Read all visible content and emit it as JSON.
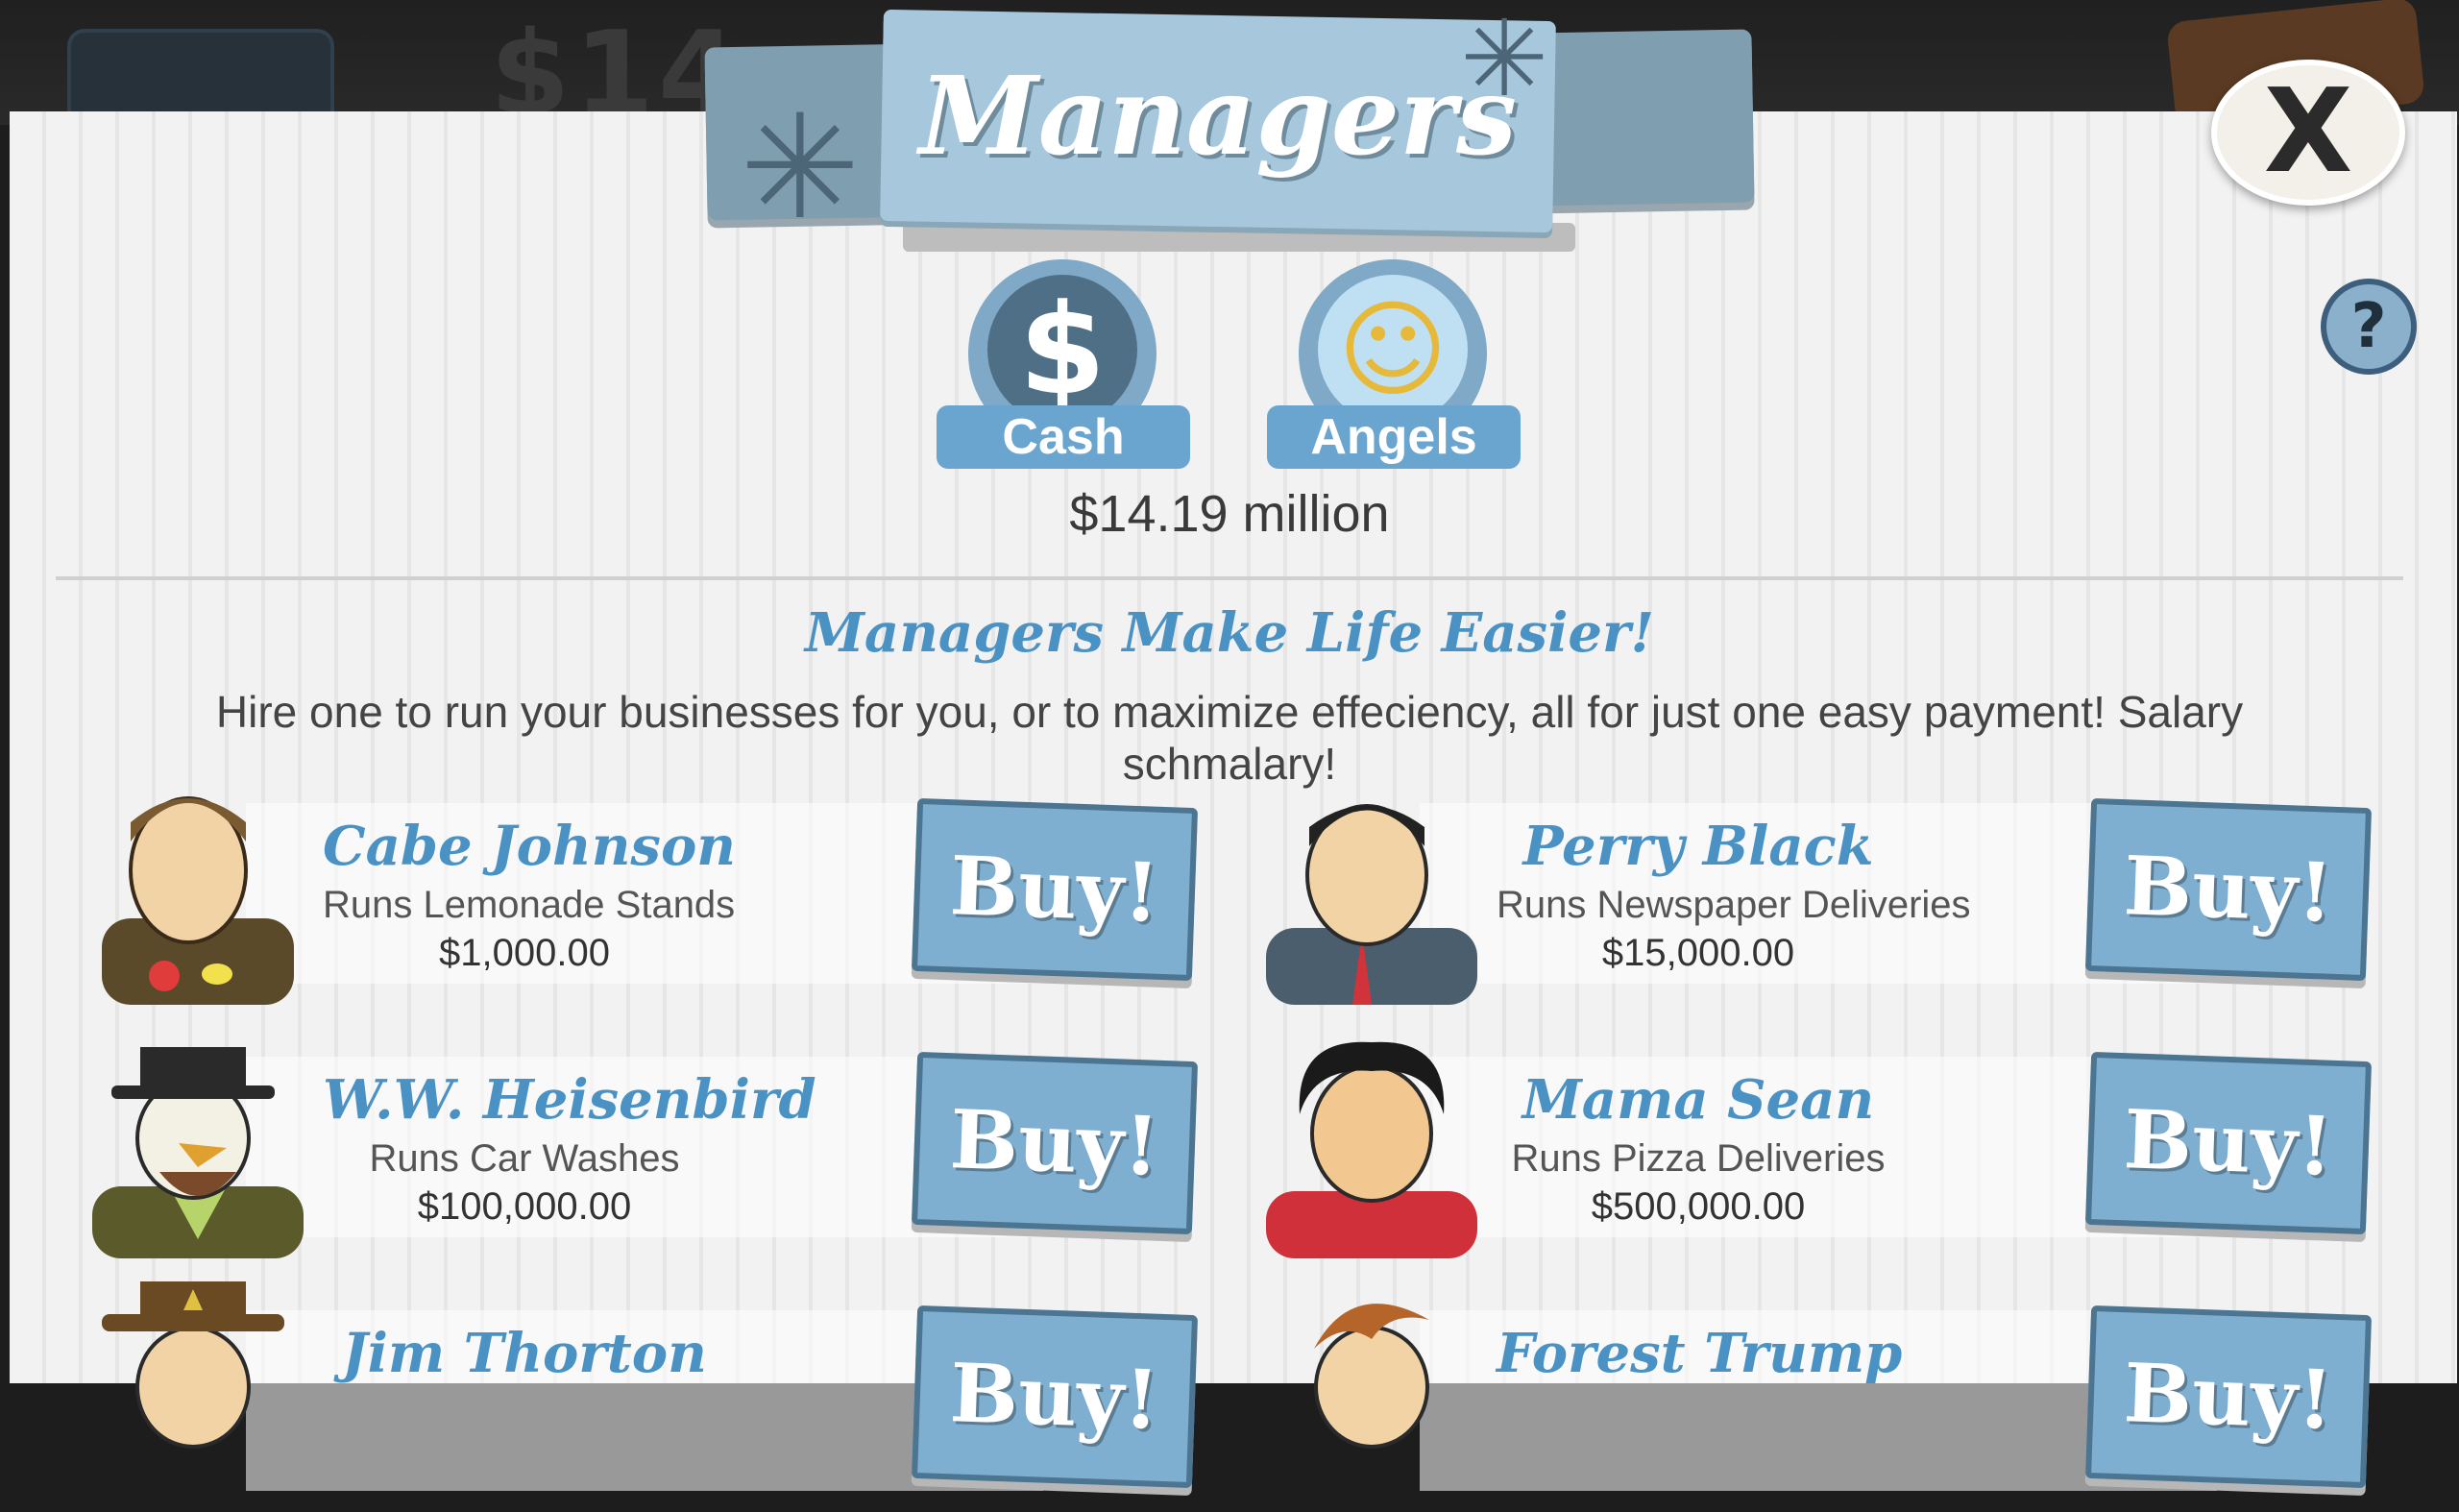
{
  "background": {
    "cash_text": "$14"
  },
  "header": {
    "title": "Managers",
    "close_label": "X",
    "help_label": "?"
  },
  "currency": {
    "cash_label": "Cash",
    "cash_symbol": "$",
    "angels_label": "Angels",
    "amount": "$14.19 million"
  },
  "intro": {
    "subtitle": "Managers Make Life Easier!",
    "description": "Hire one to run your businesses for you, or to maximize effeciency, all for just one easy payment! Salary schmalary!"
  },
  "managers": [
    {
      "name": "Cabe Johnson",
      "runs": "Runs Lemonade Stands",
      "cost": "$1,000.00",
      "buy": "Buy!"
    },
    {
      "name": "Perry Black",
      "runs": "Runs Newspaper Deliveries",
      "cost": "$15,000.00",
      "buy": "Buy!"
    },
    {
      "name": "W.W. Heisenbird",
      "runs": "Runs Car Washes",
      "cost": "$100,000.00",
      "buy": "Buy!"
    },
    {
      "name": "Mama Sean",
      "runs": "Runs Pizza Deliveries",
      "cost": "$500,000.00",
      "buy": "Buy!"
    },
    {
      "name": "Jim Thorton",
      "runs": "",
      "cost": "",
      "buy": "Buy!"
    },
    {
      "name": "Forest Trump",
      "runs": "",
      "cost": "",
      "buy": "Buy!"
    }
  ],
  "colors": {
    "accent_blue": "#4a92c4",
    "button_blue": "#7eaed0",
    "banner_blue": "#a7c8dc"
  }
}
